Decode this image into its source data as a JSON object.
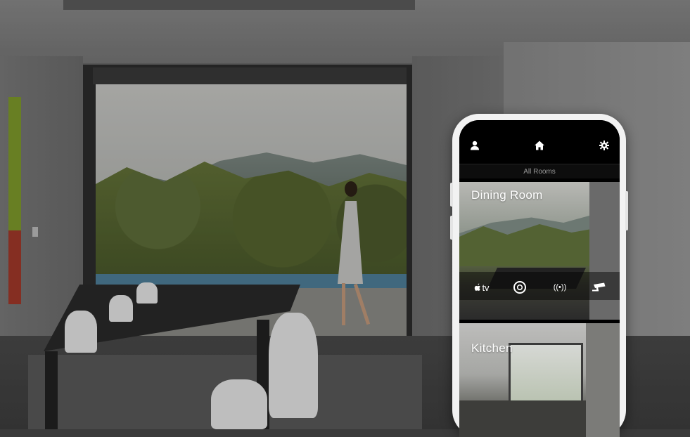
{
  "phone": {
    "header": {
      "user_icon": "user-icon",
      "home_icon": "home-icon",
      "settings_icon": "gear-icon"
    },
    "rooms_label": "All Rooms",
    "rooms": [
      {
        "name": "Dining Room",
        "devices": [
          {
            "icon": "apple-tv-icon",
            "label": "tv"
          },
          {
            "icon": "speaker-icon",
            "label": ""
          },
          {
            "icon": "wireless-icon",
            "label": "((•))"
          },
          {
            "icon": "security-camera-icon",
            "label": ""
          }
        ]
      },
      {
        "name": "Kitchen"
      }
    ]
  },
  "colors": {
    "header_bg": "#000000",
    "text": "#ffffff",
    "subtle_text": "#9a9a9a",
    "phone_body": "#f2f2f2"
  }
}
